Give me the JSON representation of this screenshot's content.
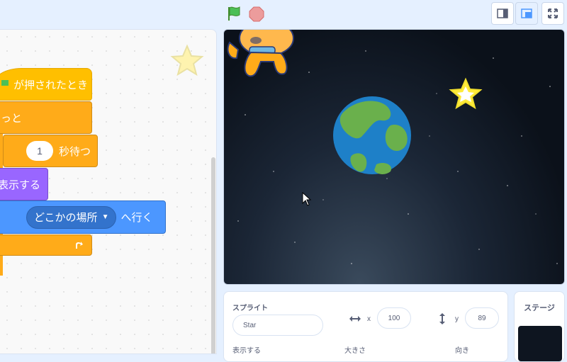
{
  "toolbar": {
    "green_flag_icon": "green-flag",
    "stop_icon": "stop-sign",
    "small_stage_icon": "small-stage",
    "normal_stage_icon": "normal-stage",
    "fullscreen_icon": "fullscreen"
  },
  "code": {
    "hat_block": "が押されたとき",
    "forever_block": "っと",
    "wait_value": "1",
    "wait_label": "秒待つ",
    "show_block": "表示する",
    "goto_dropdown": "どこかの場所",
    "goto_label": "へ行く"
  },
  "sprite_info": {
    "sprite_label": "スプライト",
    "sprite_name": "Star",
    "x_label": "x",
    "x_value": "100",
    "y_label": "y",
    "y_value": "89",
    "show_label": "表示する",
    "size_label": "大きさ",
    "direction_label": "向き"
  },
  "stage_panel": {
    "title": "ステージ"
  },
  "colors": {
    "events": "#ffbf00",
    "control": "#ffab19",
    "looks": "#9966ff",
    "motion": "#4c97ff",
    "accent": "#4c97ff"
  }
}
